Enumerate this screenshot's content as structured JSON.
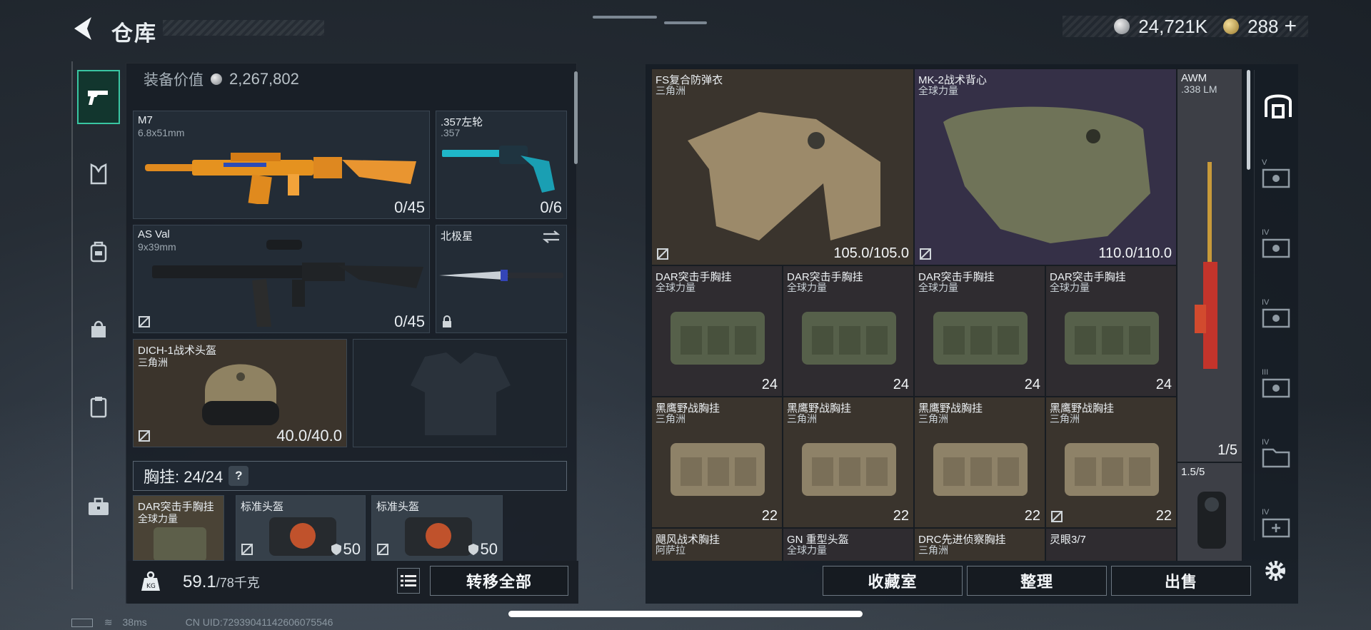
{
  "header": {
    "title": "仓库",
    "silver_amount": "24,721K",
    "gold_amount": "288",
    "plus_label": "+"
  },
  "nav": {
    "items": [
      "pistol-icon",
      "vest-icon",
      "backpack-icon",
      "bag-icon",
      "clipboard-icon",
      "briefcase-icon"
    ]
  },
  "equipment": {
    "value_label": "装备价值",
    "value": "2,267,802",
    "slots": {
      "m7": {
        "name": "M7",
        "caliber": "6.8x51mm",
        "ammo": "0/45"
      },
      "revolver": {
        "name": ".357左轮",
        "caliber": ".357",
        "ammo": "0/6"
      },
      "asval": {
        "name": "AS Val",
        "caliber": "9x39mm",
        "ammo": "0/45"
      },
      "knife": {
        "name": "北极星"
      },
      "helmet": {
        "name": "DICH-1战术头盔",
        "sub": "三角洲",
        "durability": "40.0/40.0"
      }
    },
    "chest": {
      "label": "胸挂: 24/24",
      "help": "?"
    },
    "chest_items": [
      {
        "name": "DAR突击手胸挂",
        "sub": "全球力量",
        "count": ""
      },
      {
        "name": "标准头盔",
        "sub": "",
        "count": "50"
      },
      {
        "name": "标准头盔",
        "sub": "",
        "count": "50"
      }
    ],
    "weight": "59.1",
    "weight_max": "/78千克",
    "transfer_all": "转移全部"
  },
  "stash": {
    "items": [
      {
        "name": "FS复合防弹衣",
        "sub": "三角洲",
        "value": "105.0/105.0"
      },
      {
        "name": "MK-2战术背心",
        "sub": "全球力量",
        "value": "110.0/110.0"
      },
      {
        "name": "AWM",
        "sub": ".338 LM",
        "value": "1/5"
      },
      {
        "name": "DAR突击手胸挂",
        "sub": "全球力量",
        "value": "24"
      },
      {
        "name": "DAR突击手胸挂",
        "sub": "全球力量",
        "value": "24"
      },
      {
        "name": "DAR突击手胸挂",
        "sub": "全球力量",
        "value": "24"
      },
      {
        "name": "DAR突击手胸挂",
        "sub": "全球力量",
        "value": "24"
      },
      {
        "name": "黑鹰野战胸挂",
        "sub": "三角洲",
        "value": "22"
      },
      {
        "name": "黑鹰野战胸挂",
        "sub": "三角洲",
        "value": "22"
      },
      {
        "name": "黑鹰野战胸挂",
        "sub": "三角洲",
        "value": "22"
      },
      {
        "name": "黑鹰野战胸挂",
        "sub": "三角洲",
        "value": "22"
      },
      {
        "name": "1.5/5",
        "sub": "",
        "value": ""
      },
      {
        "name": "飓风战术胸挂",
        "sub": "阿萨拉",
        "value": ""
      },
      {
        "name": "GN 重型头盔",
        "sub": "全球力量",
        "value": ""
      },
      {
        "name": "DRC先进侦察胸挂",
        "sub": "三角洲",
        "value": ""
      },
      {
        "name": "灵眼3/7",
        "sub": "",
        "value": ""
      }
    ],
    "buttons": {
      "collection": "收藏室",
      "organize": "整理",
      "sell": "出售"
    },
    "tabs": [
      "V",
      "IV",
      "IV",
      "III",
      "IV",
      "IV"
    ]
  },
  "status": {
    "ping": "38ms",
    "uid": "CN UID:72939041142606075546"
  }
}
